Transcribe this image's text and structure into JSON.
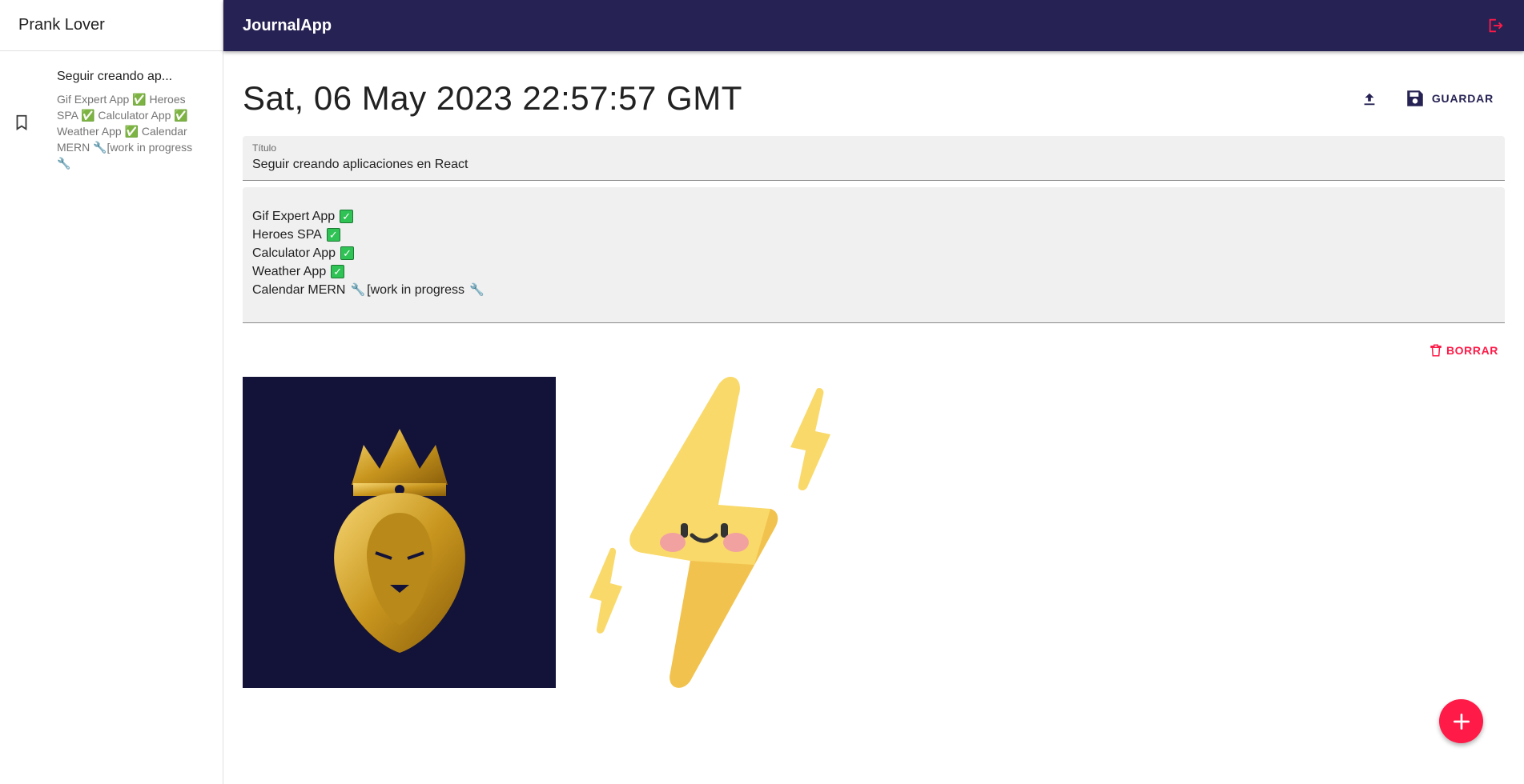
{
  "sidebar": {
    "user_name": "Prank Lover",
    "notes": [
      {
        "title": "Seguir creando ap...",
        "body": "Gif Expert App ✅ Heroes SPA ✅ Calculator App ✅ Weather App ✅ Calendar MERN 🔧[work in progress 🔧"
      }
    ]
  },
  "appbar": {
    "title": "JournalApp",
    "logout_icon": "logout-icon"
  },
  "note": {
    "date": "Sat, 06 May 2023 22:57:57 GMT",
    "upload_icon": "upload-icon",
    "save_label": "GUARDAR",
    "title_label": "Título",
    "title_value": "Seguir creando aplicaciones en React",
    "body_lines": [
      {
        "text": "Gif Expert App",
        "suffix": "check"
      },
      {
        "text": "Heroes SPA",
        "suffix": "check"
      },
      {
        "text": "Calculator App",
        "suffix": "check"
      },
      {
        "text": "Weather App",
        "suffix": "check"
      },
      {
        "text": "Calendar MERN",
        "suffix": "wrench",
        "tail": "[work in progress"
      }
    ],
    "delete_label": "BORRAR"
  },
  "images": [
    {
      "name": "lion-crown-image"
    },
    {
      "name": "lightning-bolt-image"
    }
  ],
  "colors": {
    "appbar": "#262254",
    "accent": "#ff1a47",
    "field_bg": "#f0f0f0"
  }
}
